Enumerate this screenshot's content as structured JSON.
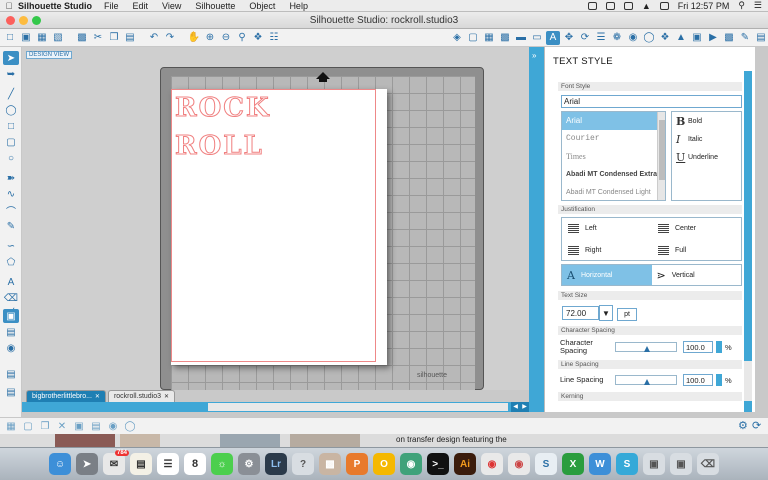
{
  "menubar": {
    "app_name": "Silhouette Studio",
    "items": [
      "File",
      "Edit",
      "View",
      "Silhouette",
      "Object",
      "Help"
    ],
    "clock": "Fri 12:57 PM"
  },
  "window": {
    "title": "Silhouette Studio: rockroll.studio3"
  },
  "workspace": {
    "design_tag": "DESIGN VIEW",
    "mat_brand": "silhouette",
    "design_lines": [
      "ROCK",
      "ROLL"
    ]
  },
  "doc_tabs": [
    {
      "label": "bigbrotherlittlebro...",
      "active": true
    },
    {
      "label": "rockroll.studio3",
      "active": false
    }
  ],
  "panel": {
    "title": "TEXT STYLE",
    "font_style_label": "Font Style",
    "font_value": "Arial",
    "fonts": [
      "Arial",
      "Courier",
      "Times",
      "Abadi MT Condensed Extra",
      "Abadi MT Condensed Light"
    ],
    "styles": [
      {
        "glyph": "B",
        "label": "Bold"
      },
      {
        "glyph": "I",
        "label": "Italic"
      },
      {
        "glyph": "U",
        "label": "Underline"
      }
    ],
    "justification_label": "Justification",
    "justify": {
      "left": "Left",
      "center": "Center",
      "right": "Right",
      "full": "Full"
    },
    "orient": {
      "horizontal": "Horizontal",
      "vertical": "Vertical"
    },
    "text_size_label": "Text Size",
    "text_size": "72.00",
    "text_size_unit": "pt",
    "char_spacing_label": "Character Spacing",
    "char_spacing_row": "Character Spacing",
    "char_spacing_value": "100.0",
    "line_spacing_label": "Line Spacing",
    "line_spacing_row": "Line Spacing",
    "line_spacing_value": "100.0",
    "percent": "%",
    "kerning_label": "Kerning"
  },
  "background": {
    "peek_text": "on transfer design featuring the"
  },
  "dock": {
    "badge_mail": "784",
    "calendar_day": "8"
  },
  "colors": {
    "accent": "#3fa7d6",
    "accent_dark": "#1f7fb3",
    "outline": "#f08080"
  }
}
